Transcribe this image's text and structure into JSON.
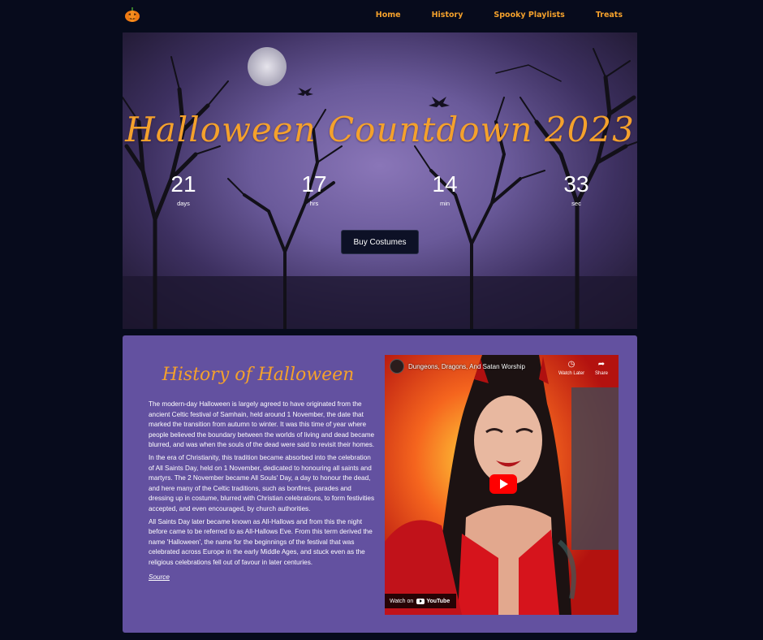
{
  "nav": {
    "logo_icon": "pumpkin-icon",
    "links": [
      "Home",
      "History",
      "Spooky Playlists",
      "Treats"
    ]
  },
  "hero": {
    "title": "Halloween Countdown 2023",
    "countdown": [
      {
        "value": "21",
        "label": "days"
      },
      {
        "value": "17",
        "label": "hrs"
      },
      {
        "value": "14",
        "label": "min"
      },
      {
        "value": "33",
        "label": "sec"
      }
    ],
    "button_label": "Buy Costumes"
  },
  "history": {
    "title": "History of Halloween",
    "paragraphs": [
      "The modern-day Halloween is largely agreed to have originated from the ancient Celtic festival of Samhain, held around 1 November, the date that marked the transition from autumn to winter. It was this time of year where people believed the boundary between the worlds of living and dead became blurred, and was when the souls of the dead were said to revisit their homes.",
      "In the era of Christianity, this tradition became absorbed into the celebration of All Saints Day, held on 1 November, dedicated to honouring all saints and martyrs. The 2 November became All Souls' Day, a day to honour the dead, and here many of the Celtic traditions, such as bonfires, parades and dressing up in costume, blurred with Christian celebrations, to form festivities accepted, and even encouraged, by church authorities.",
      "All Saints Day later became known as All-Hallows and from this the night before came to be referred to as All-Hallows Eve. From this term derived the name 'Halloween', the name for the beginnings of the festival that was celebrated across Europe in the early Middle Ages, and stuck even as the religious celebrations fell out of favour in later centuries."
    ],
    "source_label": "Source"
  },
  "video": {
    "title": "Dungeons, Dragons, And Satan Worship",
    "watch_later": "Watch Later",
    "share": "Share",
    "watch_on": "Watch on",
    "youtube": "YouTube"
  },
  "colors": {
    "accent": "#f4a12c",
    "background": "#070b1c",
    "panel": "#6351a0"
  }
}
